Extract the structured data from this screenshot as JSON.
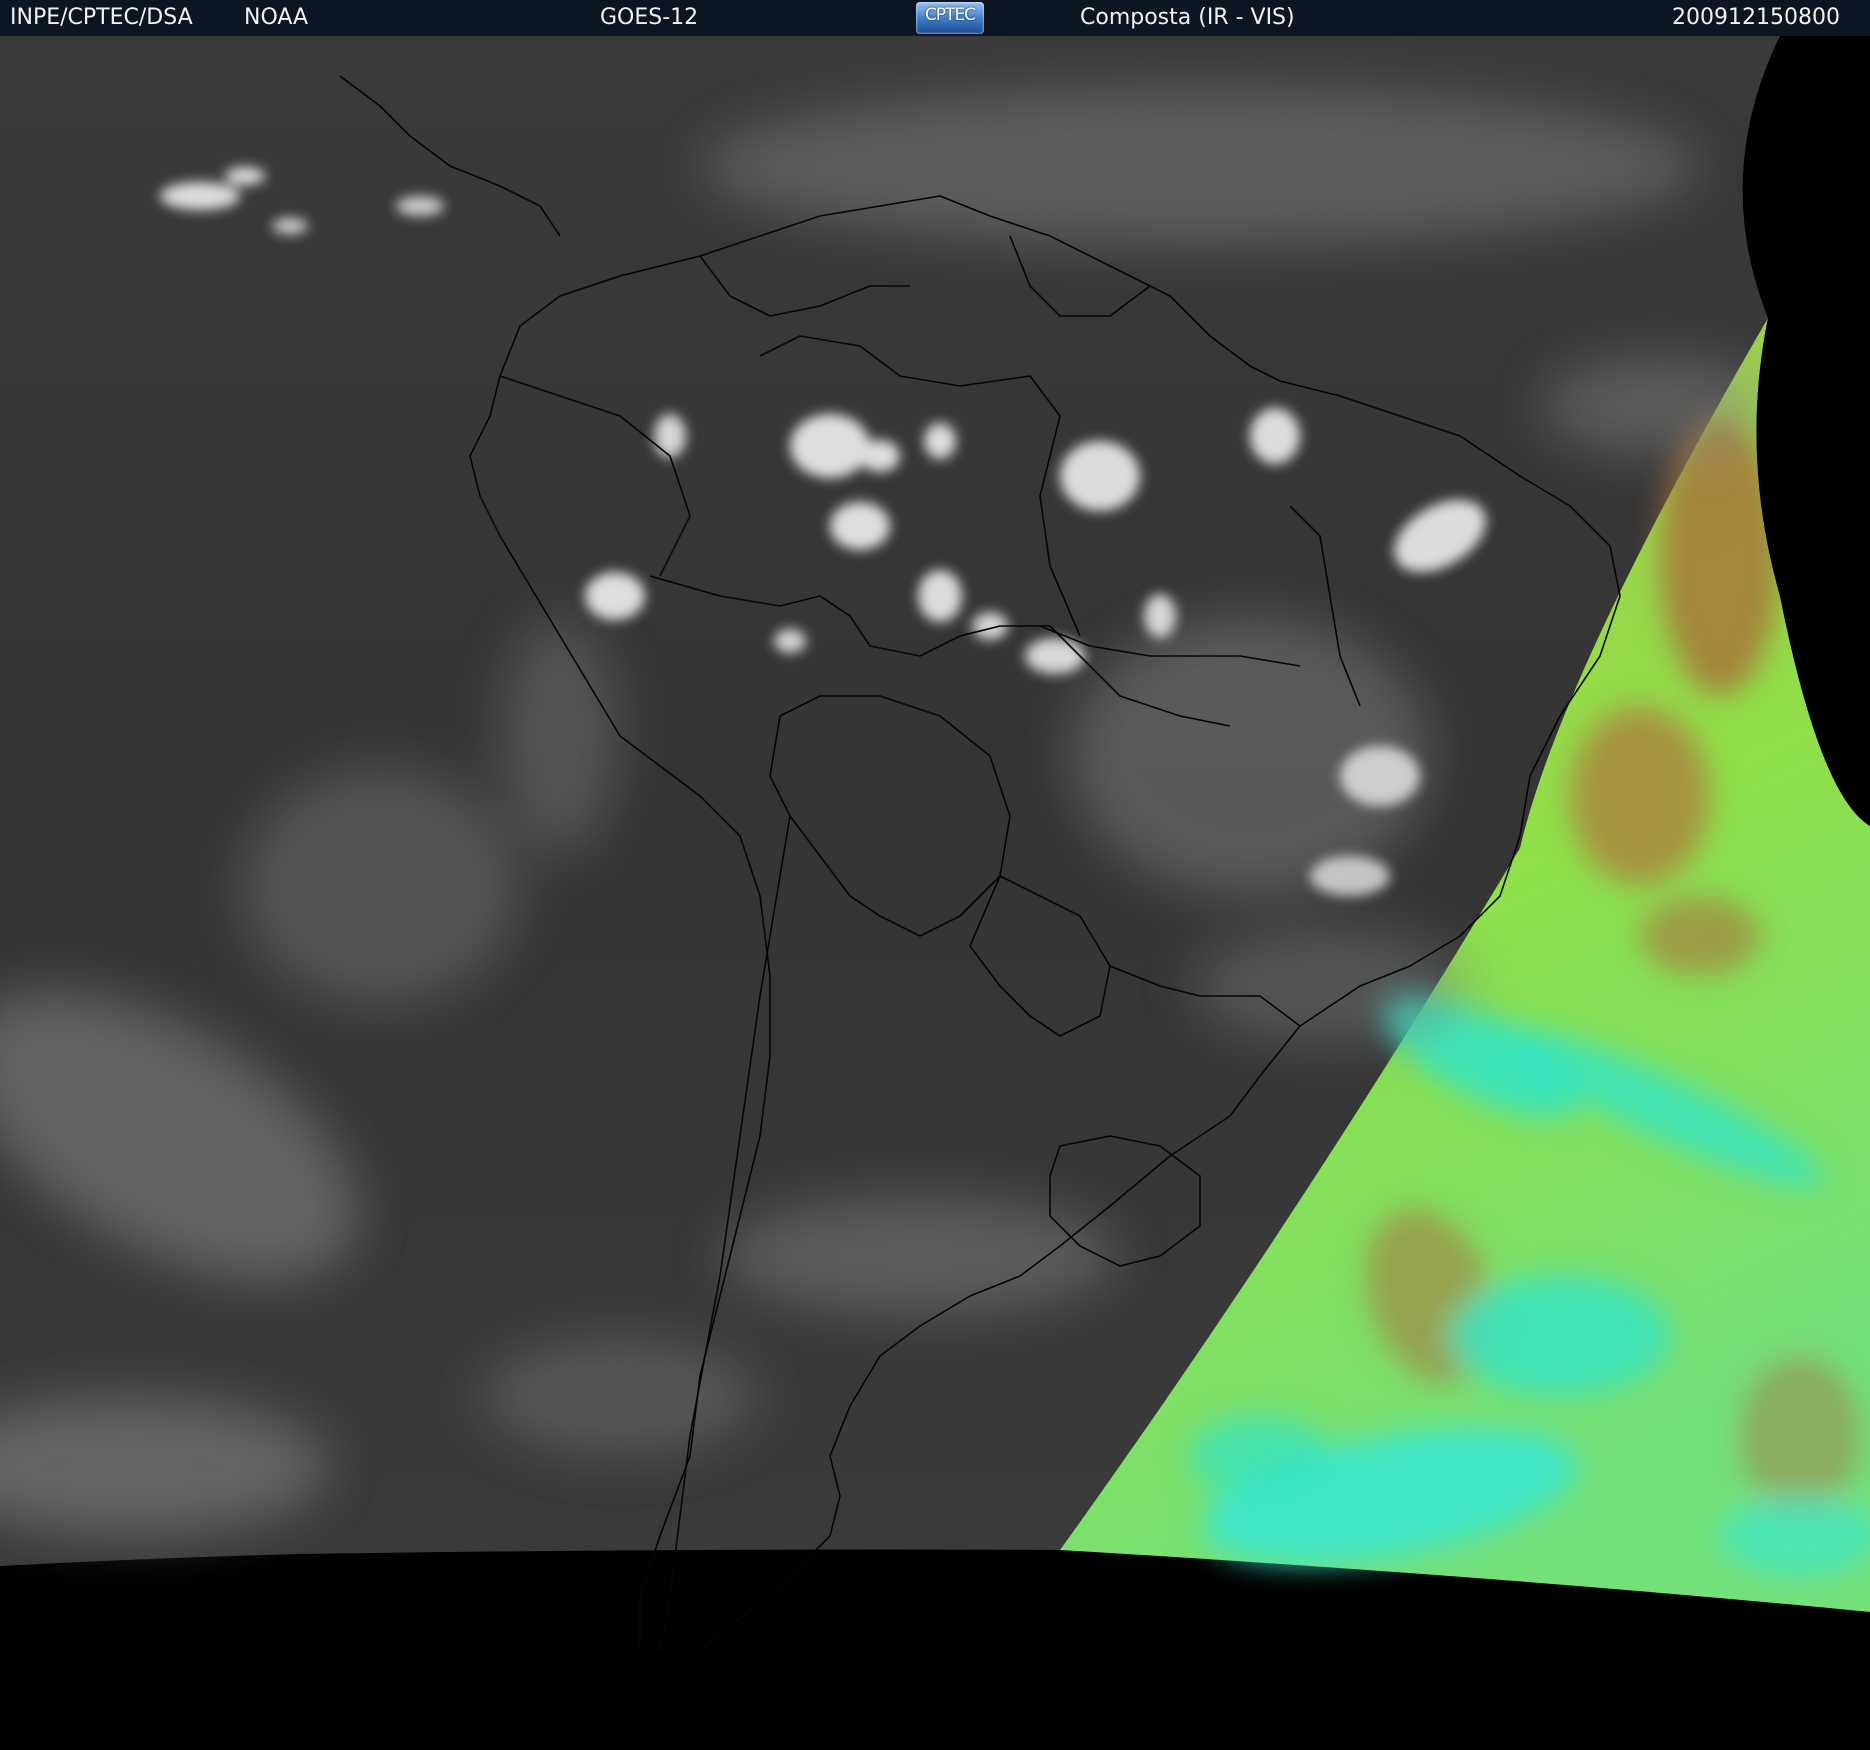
{
  "header": {
    "org": "INPE/CPTEC/DSA",
    "agency": "NOAA",
    "satellite": "GOES-12",
    "logo_text": "CPTEC",
    "product": "Composta (IR - VIS)",
    "datetime": "200912150800"
  },
  "colors": {
    "header_bg": "#0c1522",
    "space": "#000000",
    "ir_background": "#333333",
    "cloud_white": "#e6e6e6",
    "vis_green": "#8fe04a",
    "vis_cyan": "#34e6c8",
    "vis_brown": "#a8703a",
    "border_lines": "#050505"
  },
  "icons": {
    "logo": "cptec-logo-icon"
  }
}
